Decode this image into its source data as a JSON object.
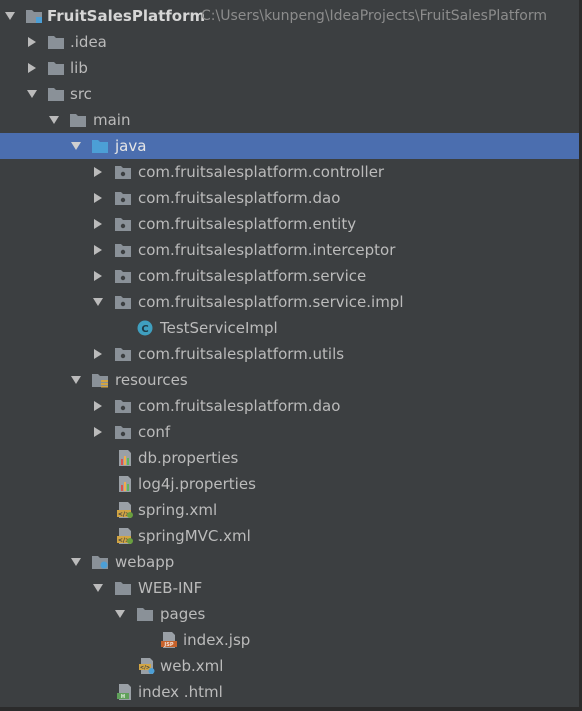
{
  "colors": {
    "background": "#3c3f41",
    "selection": "#4b6eaf",
    "text": "#bbbbbb",
    "folder": "#8a9198",
    "source_folder": "#4c9fd6",
    "class_icon": "#3f9fbf"
  },
  "project": {
    "name": "FruitSalesPlatform",
    "path": "C:\\Users\\kunpeng\\IdeaProjects\\FruitSalesPlatform"
  },
  "nodes": [
    {
      "label": "FruitSalesPlatform",
      "icon": "module-folder-icon",
      "expanded": true
    },
    {
      "label": ".idea",
      "icon": "folder-icon",
      "expanded": false
    },
    {
      "label": "lib",
      "icon": "folder-icon",
      "expanded": false
    },
    {
      "label": "src",
      "icon": "folder-icon",
      "expanded": true
    },
    {
      "label": "main",
      "icon": "folder-icon",
      "expanded": true
    },
    {
      "label": "java",
      "icon": "source-folder-icon",
      "expanded": true,
      "selected": true
    },
    {
      "label": "com.fruitsalesplatform.controller",
      "icon": "package-icon",
      "expanded": false
    },
    {
      "label": "com.fruitsalesplatform.dao",
      "icon": "package-icon",
      "expanded": false
    },
    {
      "label": "com.fruitsalesplatform.entity",
      "icon": "package-icon",
      "expanded": false
    },
    {
      "label": "com.fruitsalesplatform.interceptor",
      "icon": "package-icon",
      "expanded": false
    },
    {
      "label": "com.fruitsalesplatform.service",
      "icon": "package-icon",
      "expanded": false
    },
    {
      "label": "com.fruitsalesplatform.service.impl",
      "icon": "package-icon",
      "expanded": true
    },
    {
      "label": "TestServiceImpl",
      "icon": "class-icon"
    },
    {
      "label": "com.fruitsalesplatform.utils",
      "icon": "package-icon",
      "expanded": false
    },
    {
      "label": "resources",
      "icon": "resources-folder-icon",
      "expanded": true
    },
    {
      "label": "com.fruitsalesplatform.dao",
      "icon": "package-icon",
      "expanded": false
    },
    {
      "label": "conf",
      "icon": "package-icon",
      "expanded": false
    },
    {
      "label": "db.properties",
      "icon": "properties-file-icon"
    },
    {
      "label": "log4j.properties",
      "icon": "properties-file-icon"
    },
    {
      "label": "spring.xml",
      "icon": "spring-xml-icon"
    },
    {
      "label": "springMVC.xml",
      "icon": "spring-xml-icon"
    },
    {
      "label": "webapp",
      "icon": "web-folder-icon",
      "expanded": true
    },
    {
      "label": "WEB-INF",
      "icon": "folder-icon",
      "expanded": true
    },
    {
      "label": "pages",
      "icon": "folder-icon",
      "expanded": true
    },
    {
      "label": "index.jsp",
      "icon": "jsp-file-icon"
    },
    {
      "label": "web.xml",
      "icon": "web-xml-icon"
    },
    {
      "label": "index .html",
      "icon": "html-file-icon"
    }
  ]
}
